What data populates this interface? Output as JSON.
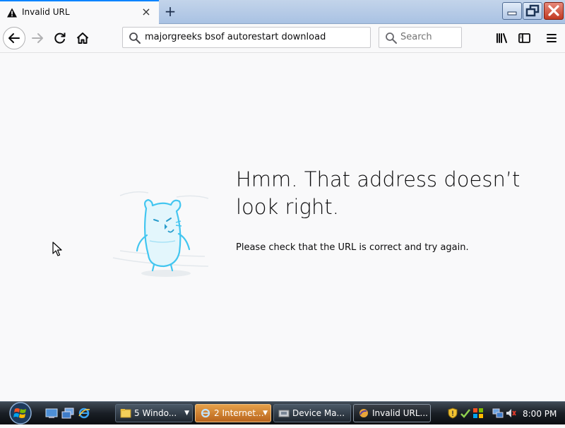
{
  "tab": {
    "title": "Invalid URL",
    "close_glyph": "×",
    "icon": "warning-icon"
  },
  "newtab": {
    "glyph": "+"
  },
  "window_controls": {
    "minimize": "minimize-icon",
    "maximize": "restore-icon",
    "close": "close-icon"
  },
  "navbar": {
    "url": "majorgreeks bsof autorestart download",
    "search_placeholder": "Search"
  },
  "error": {
    "title": "Hmm. That address doesn’t look right.",
    "description": "Please check that the URL is correct and try again."
  },
  "taskbar": {
    "tasks": [
      {
        "label": "5 Windo...",
        "icon": "folder-icon",
        "has_menu": true
      },
      {
        "label": "2 Internet...",
        "icon": "ie-icon",
        "has_menu": true
      },
      {
        "label": "Device Ma...",
        "icon": "device-manager-icon",
        "has_menu": false
      },
      {
        "label": "Invalid URL...",
        "icon": "firefox-icon",
        "has_menu": false
      }
    ],
    "clock": "8:00 PM"
  },
  "colors": {
    "accent": "#0a84ff",
    "page_bg": "#f9f9fa",
    "ie_task": "#d9892f"
  }
}
